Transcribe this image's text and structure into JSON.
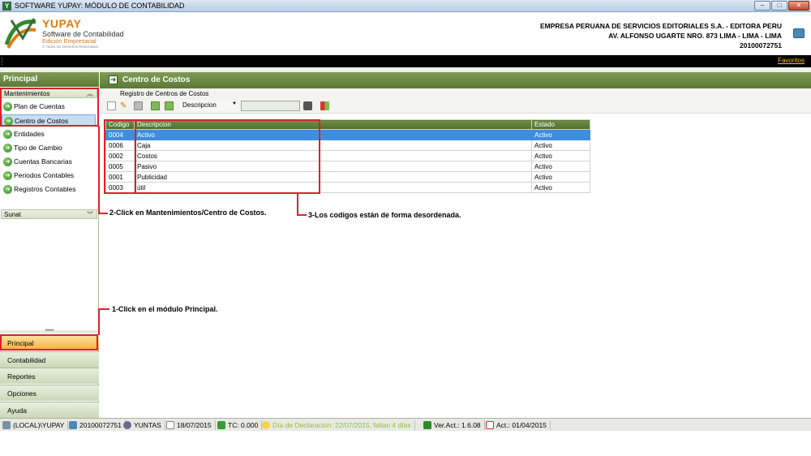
{
  "window": {
    "title": "SOFTWARE YUPAY: MÓDULO DE CONTABILIDAD"
  },
  "brand": {
    "name": "YUPAY",
    "subtitle": "Software de Contabilidad",
    "edition": "Edición Empresarial",
    "rights": "© Todos los Derechos Reservados"
  },
  "company": {
    "name": "EMPRESA PERUANA DE SERVICIOS EDITORIALES S.A. - EDITORA PERU",
    "address": "AV. ALFONSO UGARTE NRO. 873 LIMA - LIMA - LIMA",
    "ruc": "20100072751"
  },
  "favorites_label": "Favoritos",
  "sidebar": {
    "title": "Principal",
    "sections": [
      {
        "label": "Mantenimientos",
        "items": [
          {
            "label": "Plan de Cuentas"
          },
          {
            "label": "Centro de Costos"
          },
          {
            "label": "Entidades"
          },
          {
            "label": "Tipo de Cambio"
          },
          {
            "label": "Cuentas Bancarias"
          },
          {
            "label": "Periodos Contables"
          },
          {
            "label": "Registros Contables"
          }
        ]
      },
      {
        "label": "Sunat"
      }
    ],
    "splitter": "•••••",
    "modules": [
      {
        "label": "Principal"
      },
      {
        "label": "Contabilidad"
      },
      {
        "label": "Reportes"
      },
      {
        "label": "Opciones"
      },
      {
        "label": "Ayuda"
      }
    ]
  },
  "main": {
    "title": "Centro de Costos",
    "subtab": "Registro de Centros de Costos",
    "filter": {
      "selected": "Descripcion",
      "value": ""
    },
    "table": {
      "columns": [
        "Codigo",
        "Descripcion",
        "Estado"
      ],
      "rows": [
        [
          "0004",
          "Activo",
          "Activo"
        ],
        [
          "0006",
          "Caja",
          "Activo"
        ],
        [
          "0002",
          "Costos",
          "Activo"
        ],
        [
          "0005",
          "Pasivo",
          "Activo"
        ],
        [
          "0001",
          "Publicidad",
          "Activo"
        ],
        [
          "0003",
          "útil",
          "Activo"
        ]
      ]
    }
  },
  "annotations": {
    "step1": "1-Click en el módulo Principal.",
    "step2": "2-Click en Mantenimientos/Centro de Costos.",
    "step3": "3-Los codigos están de forma desordenada."
  },
  "statusbar": [
    {
      "text": "(LOCAL)\\YUPAY",
      "icon": "server-icon"
    },
    {
      "text": "20100072751",
      "icon": "company-icon"
    },
    {
      "text": "YUNTAS",
      "icon": "user-icon"
    },
    {
      "text": "18/07/2015",
      "icon": "calendar-icon"
    },
    {
      "text": "TC: 0.000",
      "icon": "dollar-icon"
    },
    {
      "text": "Día de Declaración: 22/07/2015, faltan 4 días",
      "icon": "lightbulb-icon"
    },
    {
      "text": "Ver.Act.: 1.6.08",
      "icon": "version-icon"
    },
    {
      "text": "Act.: 01/04/2015",
      "icon": "calendar-icon"
    }
  ],
  "colors": {
    "accent_green": "#5a7a34",
    "annotation_red": "#d6232e",
    "selection_blue": "#3d8ee0",
    "module_active": "#f6ae3a"
  }
}
